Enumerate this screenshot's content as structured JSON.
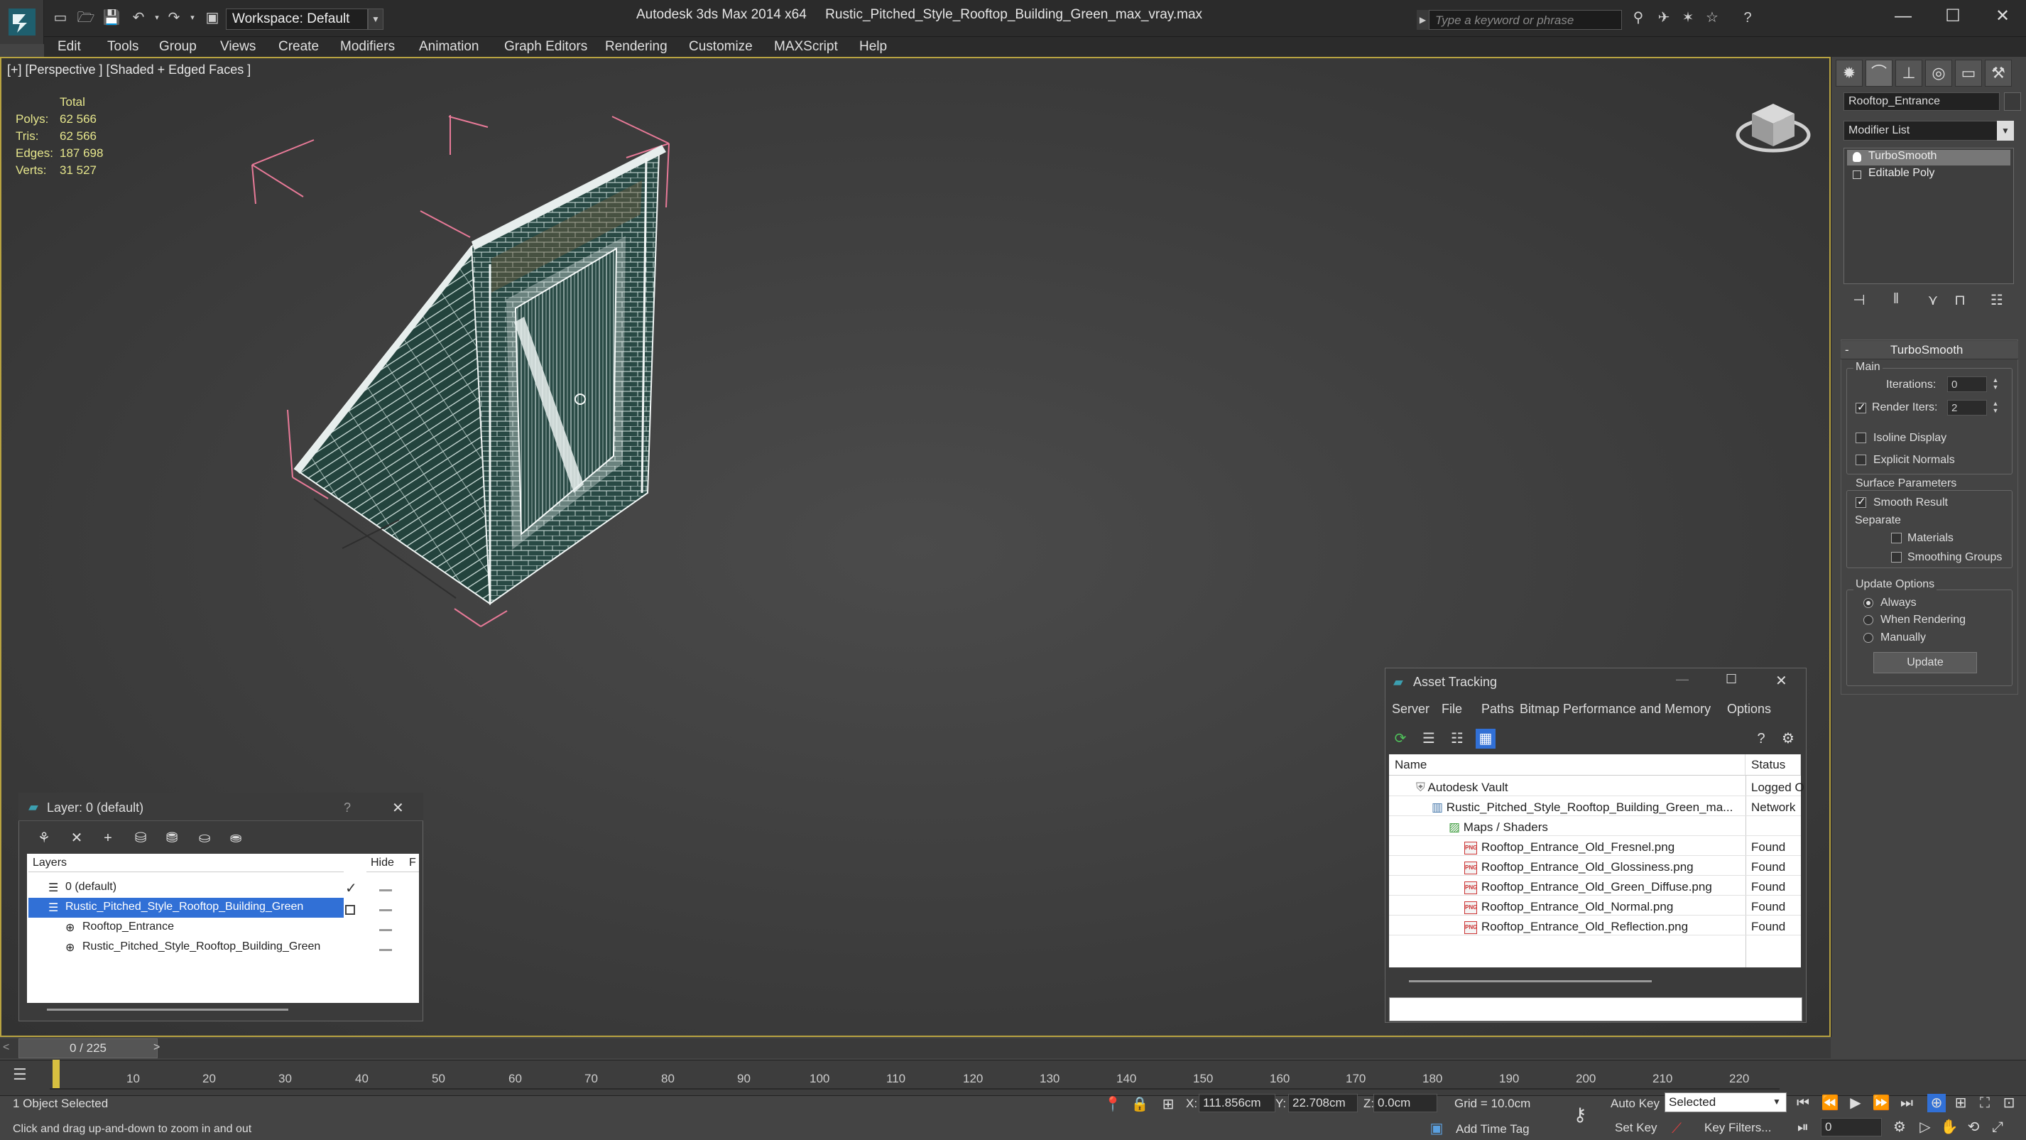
{
  "title_bar": {
    "app": "Autodesk 3ds Max  2014 x64",
    "file": "Rustic_Pitched_Style_Rooftop_Building_Green_max_vray.max",
    "workspace": "Workspace: Default",
    "search_placeholder": "Type a keyword or phrase",
    "window_controls": [
      "minimize-icon",
      "maximize-icon",
      "close-icon"
    ]
  },
  "menu": [
    "Edit",
    "Tools",
    "Group",
    "Views",
    "Create",
    "Modifiers",
    "Animation",
    "Graph Editors",
    "Rendering",
    "Customize",
    "MAXScript",
    "Help"
  ],
  "viewport": {
    "label": "[+] [Perspective ] [Shaded + Edged Faces ]",
    "stats": {
      "total_label": "Total",
      "rows": [
        {
          "label": "Polys:",
          "value": "62 566"
        },
        {
          "label": "Tris:",
          "value": "62 566"
        },
        {
          "label": "Edges:",
          "value": "187 698"
        },
        {
          "label": "Verts:",
          "value": "31 527"
        }
      ]
    },
    "viewcube_icon": "viewcube-icon"
  },
  "command_panel": {
    "object_name": "Rooftop_Entrance",
    "modifier_list": "Modifier List",
    "stack": [
      "TurboSmooth",
      "Editable Poly"
    ],
    "turbosmooth": {
      "title": "TurboSmooth",
      "main_label": "Main",
      "iterations_label": "Iterations:",
      "iterations_value": "0",
      "render_iters_label": "Render Iters:",
      "render_iters_value": "2",
      "render_iters_checked": true,
      "isoline_label": "Isoline Display",
      "explicit_normals_label": "Explicit Normals",
      "surface_params_label": "Surface Parameters",
      "smooth_result_label": "Smooth Result",
      "separate_label": "Separate",
      "materials_label": "Materials",
      "smoothing_groups_label": "Smoothing Groups",
      "update_options_label": "Update Options",
      "always_label": "Always",
      "when_rendering_label": "When Rendering",
      "manually_label": "Manually",
      "update_button": "Update"
    }
  },
  "layer_dialog": {
    "title": "Layer: 0 (default)",
    "help": "?",
    "col_layers": "Layers",
    "col_hide": "Hide",
    "col_f": "F",
    "rows": [
      {
        "name": "0 (default)"
      },
      {
        "name": "Rustic_Pitched_Style_Rooftop_Building_Green"
      },
      {
        "name": "Rooftop_Entrance"
      },
      {
        "name": "Rustic_Pitched_Style_Rooftop_Building_Green"
      }
    ]
  },
  "asset_tracking": {
    "title": "Asset Tracking",
    "menu": [
      "Server",
      "File",
      "Paths",
      "Bitmap Performance and Memory",
      "Options"
    ],
    "col_name": "Name",
    "col_status": "Status",
    "rows": [
      {
        "name": "Autodesk Vault",
        "status": "Logged O"
      },
      {
        "name": "Rustic_Pitched_Style_Rooftop_Building_Green_ma...",
        "status": "Network"
      },
      {
        "name": "Maps / Shaders",
        "status": ""
      },
      {
        "name": "Rooftop_Entrance_Old_Fresnel.png",
        "status": "Found"
      },
      {
        "name": "Rooftop_Entrance_Old_Glossiness.png",
        "status": "Found"
      },
      {
        "name": "Rooftop_Entrance_Old_Green_Diffuse.png",
        "status": "Found"
      },
      {
        "name": "Rooftop_Entrance_Old_Normal.png",
        "status": "Found"
      },
      {
        "name": "Rooftop_Entrance_Old_Reflection.png",
        "status": "Found"
      }
    ]
  },
  "timeline": {
    "slider_text": "0 / 225",
    "ticks": [
      "10",
      "20",
      "30",
      "40",
      "50",
      "60",
      "70",
      "80",
      "90",
      "100",
      "110",
      "120",
      "130",
      "140",
      "150",
      "160",
      "170",
      "180",
      "190",
      "200",
      "210",
      "220"
    ]
  },
  "status_bar": {
    "selection": "1 Object Selected",
    "prompt": "Click and drag up-and-down to zoom in and out",
    "x_label": "X:",
    "x_value": "111.856cm",
    "y_label": "Y:",
    "y_value": "22.708cm",
    "z_label": "Z:",
    "z_value": "0.0cm",
    "grid": "Grid = 10.0cm",
    "auto_key": "Auto Key",
    "set_key": "Set Key",
    "selected": "Selected",
    "key_filters": "Key Filters...",
    "add_time_tag": "Add Time Tag",
    "frame": "0"
  }
}
